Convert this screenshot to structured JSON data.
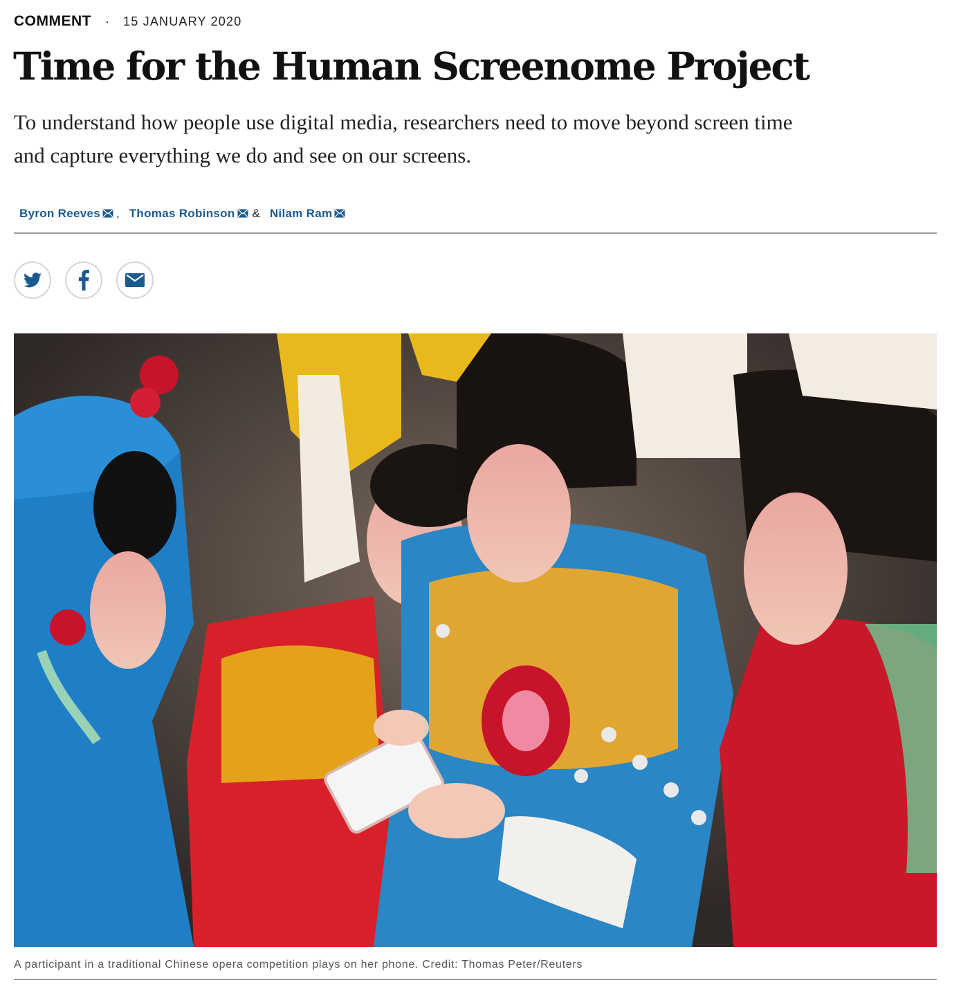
{
  "article": {
    "type": "COMMENT",
    "separator": "·",
    "date": "15 JANUARY 2020",
    "title": "Time for the Human Screenome Project",
    "standfirst": "To understand how people use digital media, researchers need to move beyond screen time and capture everything we do and see on our screens."
  },
  "authors": [
    {
      "name": "Byron Reeves",
      "icon": "mail-icon"
    },
    {
      "name": "Thomas Robinson",
      "icon": "mail-icon"
    },
    {
      "name": "Nilam Ram",
      "icon": "mail-icon"
    }
  ],
  "author_separators": {
    "comma": ",",
    "amp": "&"
  },
  "share": {
    "buttons": [
      {
        "icon": "twitter-icon"
      },
      {
        "icon": "facebook-icon"
      },
      {
        "icon": "email-icon"
      }
    ],
    "icon_color": "#1a5a8f",
    "border_color": "#d5d5d5"
  },
  "figure": {
    "alt_subject": "children in traditional Chinese opera costumes looking at a phone",
    "caption": "A participant in a traditional Chinese opera competition plays on her phone. Credit: Thomas Peter/Reuters"
  },
  "colors": {
    "author_link": "#1a5a8f",
    "title": "#111111",
    "rule": "#9b9b9b"
  }
}
